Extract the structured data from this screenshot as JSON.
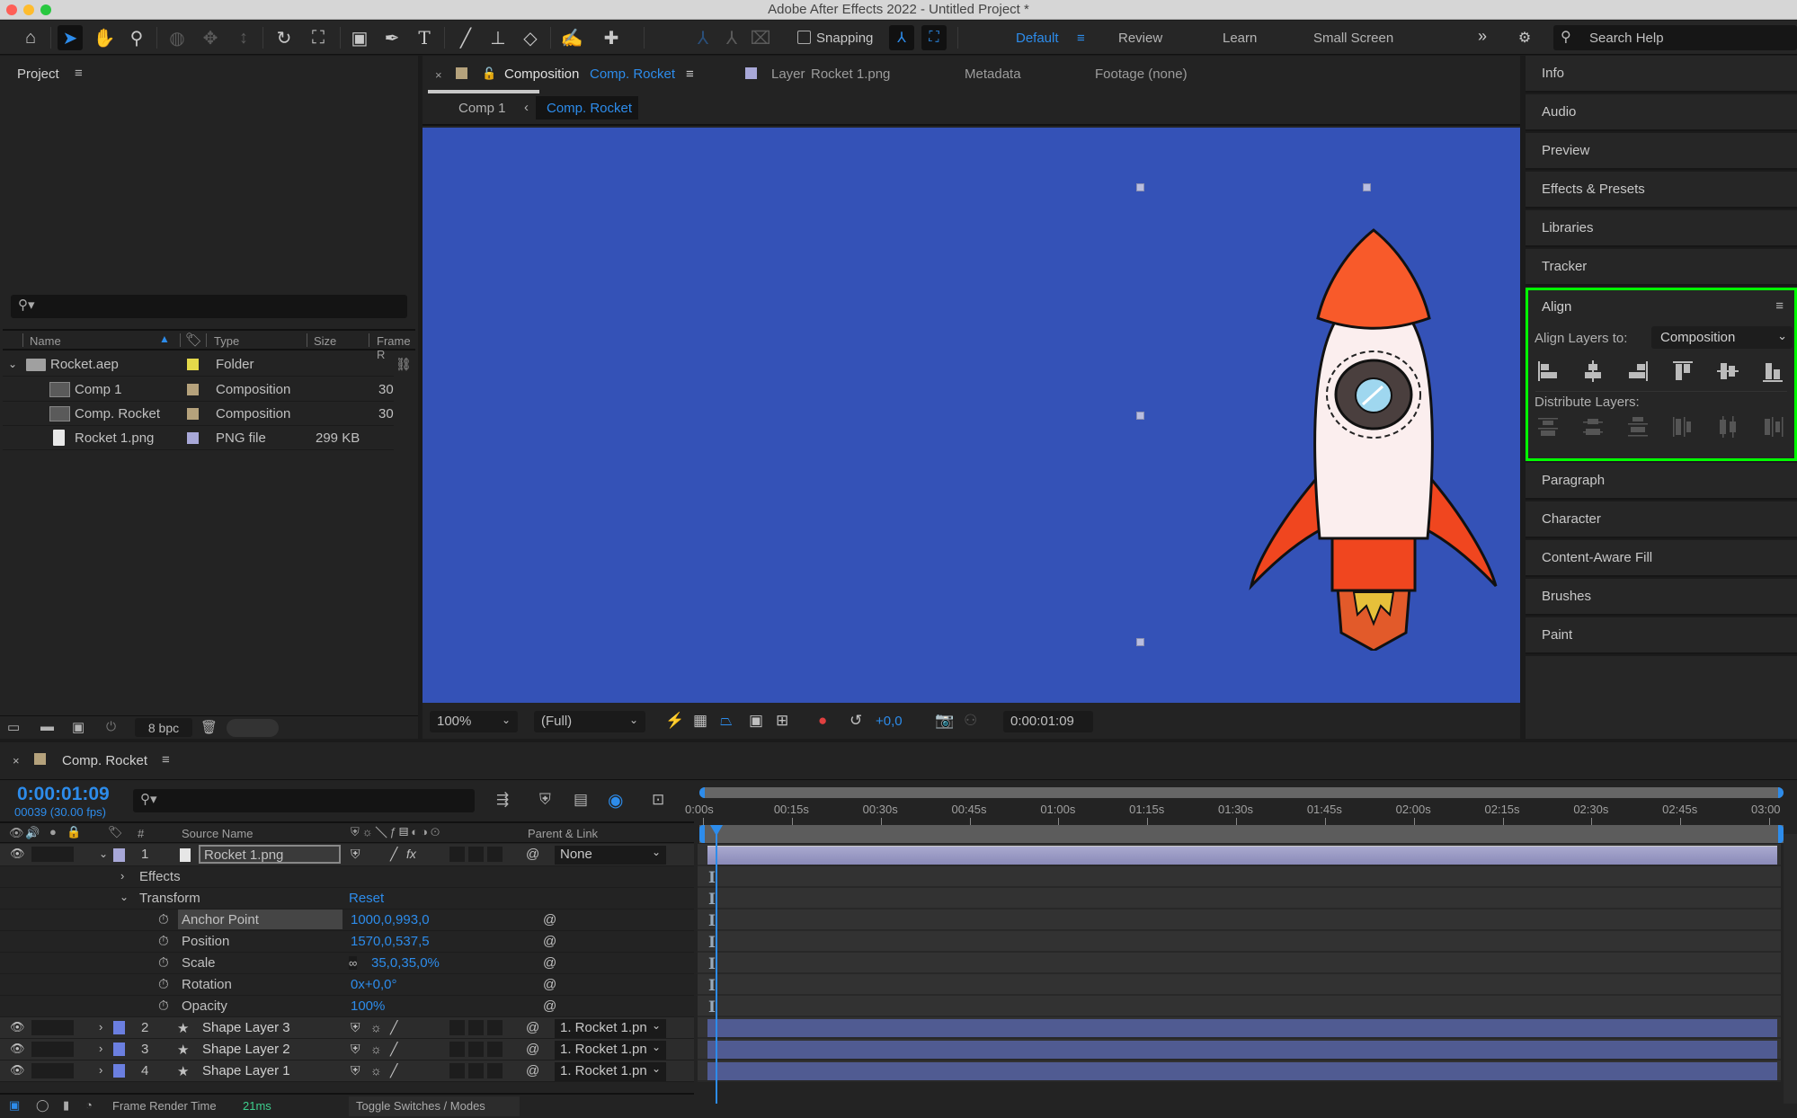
{
  "window": {
    "title": "Adobe After Effects 2022 - Untitled Project *",
    "traffic_lights": {
      "close": "#fe5f57",
      "minimize": "#febc2e",
      "maximize": "#28c840"
    }
  },
  "toolbar": {
    "tools": [
      {
        "name": "home-icon",
        "glyph": "⌂"
      },
      {
        "name": "selection-tool-icon",
        "glyph": "➤",
        "selected": true
      },
      {
        "name": "hand-tool-icon",
        "glyph": "✋"
      },
      {
        "name": "zoom-tool-icon",
        "glyph": "⚲"
      },
      {
        "name": "orbit-camera-icon",
        "glyph": "◍"
      },
      {
        "name": "pan-camera-icon",
        "glyph": "✥"
      },
      {
        "name": "dolly-camera-icon",
        "glyph": "↕"
      },
      {
        "name": "rotation-tool-icon",
        "glyph": "↻"
      },
      {
        "name": "pan-behind-tool-icon",
        "glyph": "⛶"
      },
      {
        "name": "rectangle-tool-icon",
        "glyph": "▣"
      },
      {
        "name": "pen-tool-icon",
        "glyph": "✒"
      },
      {
        "name": "type-tool-icon",
        "glyph": "T"
      },
      {
        "name": "brush-tool-icon",
        "glyph": "🖌"
      },
      {
        "name": "clone-stamp-tool-icon",
        "glyph": "⊥"
      },
      {
        "name": "eraser-tool-icon",
        "glyph": "◇"
      },
      {
        "name": "roto-brush-tool-icon",
        "glyph": "✍"
      },
      {
        "name": "puppet-pin-tool-icon",
        "glyph": "📌"
      }
    ],
    "snapping_label": "Snapping",
    "workspaces": [
      "Default",
      "Review",
      "Learn",
      "Small Screen"
    ],
    "active_workspace": "Default",
    "more_label": "»",
    "search_placeholder": "Search Help"
  },
  "project_panel": {
    "title": "Project",
    "search_placeholder": "",
    "columns": [
      "Name",
      "Type",
      "Size",
      "Frame R"
    ],
    "items": [
      {
        "name": "Rocket.aep",
        "type": "Folder",
        "size": "",
        "frame": "",
        "color": "#e4d94a",
        "icon": "folder-icon",
        "expanded": true
      },
      {
        "name": "Comp 1",
        "type": "Composition",
        "size": "",
        "frame": "30",
        "color": "#b5a27c",
        "icon": "composition-icon"
      },
      {
        "name": "Comp. Rocket",
        "type": "Composition",
        "size": "",
        "frame": "30",
        "color": "#b5a27c",
        "icon": "composition-icon"
      },
      {
        "name": "Rocket 1.png",
        "type": "PNG file",
        "size": "299 KB",
        "frame": "",
        "color": "#a8a8d8",
        "icon": "png-file-icon"
      }
    ],
    "footer": {
      "bpc": "8 bpc"
    }
  },
  "viewer": {
    "tabs": [
      {
        "prefix": "Composition",
        "name": "Comp. Rocket",
        "active": true
      },
      {
        "prefix": "Layer",
        "name": "Rocket 1.png"
      },
      {
        "prefix": "",
        "name": "Metadata"
      },
      {
        "prefix": "",
        "name": "Footage (none)"
      }
    ],
    "breadcrumbs": [
      "Comp 1",
      "Comp. Rocket"
    ],
    "canvas_bg": "#3452b7",
    "zoom": "100%",
    "resolution": "(Full)",
    "exposure": "+0,0",
    "timecode": "0:00:01:09"
  },
  "right_panels": {
    "top": [
      "Info",
      "Audio",
      "Preview",
      "Effects & Presets",
      "Libraries",
      "Tracker"
    ],
    "align": {
      "title": "Align",
      "align_to_label": "Align Layers to:",
      "align_to_value": "Composition",
      "align_buttons": [
        "align-left",
        "align-horizontal-center",
        "align-right",
        "align-top",
        "align-vertical-center",
        "align-bottom"
      ],
      "distribute_label": "Distribute Layers:",
      "distribute_buttons": [
        "distribute-top",
        "distribute-vertical-center",
        "distribute-bottom",
        "distribute-left",
        "distribute-horizontal-center",
        "distribute-right"
      ],
      "highlight_color": "#00ff00"
    },
    "bottom": [
      "Paragraph",
      "Character",
      "Content-Aware Fill",
      "Brushes",
      "Paint"
    ]
  },
  "timeline": {
    "comp_name": "Comp. Rocket",
    "timecode": "0:00:01:09",
    "frame_info": "00039 (30.00 fps)",
    "columns": {
      "num": "#",
      "source": "Source Name",
      "parent": "Parent & Link"
    },
    "ruler_ticks": [
      "0:00s",
      "00:15s",
      "00:30s",
      "00:45s",
      "01:00s",
      "01:15s",
      "01:30s",
      "01:45s",
      "02:00s",
      "02:15s",
      "02:30s",
      "02:45s",
      "03:00"
    ],
    "layers": [
      {
        "num": "1",
        "name": "Rocket 1.png",
        "color": "#a8a8d8",
        "parent": "None",
        "expanded": true,
        "icon": "png-file-icon"
      },
      {
        "num": "2",
        "name": "Shape Layer 3",
        "color": "#6b7fe0",
        "parent": "1. Rocket 1.pn",
        "icon": "star-icon"
      },
      {
        "num": "3",
        "name": "Shape Layer 2",
        "color": "#6b7fe0",
        "parent": "1. Rocket 1.pn",
        "icon": "star-icon"
      },
      {
        "num": "4",
        "name": "Shape Layer 1",
        "color": "#6b7fe0",
        "parent": "1. Rocket 1.pn",
        "icon": "star-icon"
      }
    ],
    "effects_label": "Effects",
    "transform_label": "Transform",
    "reset_label": "Reset",
    "properties": [
      {
        "name": "Anchor Point",
        "value": "1000,0,993,0"
      },
      {
        "name": "Position",
        "value": "1570,0,537,5"
      },
      {
        "name": "Scale",
        "value": "35,0,35,0%"
      },
      {
        "name": "Rotation",
        "value": "0x+0,0°"
      },
      {
        "name": "Opacity",
        "value": "100%"
      }
    ],
    "footer": {
      "render_time_label": "Frame Render Time",
      "render_time": "21ms",
      "toggle_label": "Toggle Switches / Modes"
    }
  }
}
